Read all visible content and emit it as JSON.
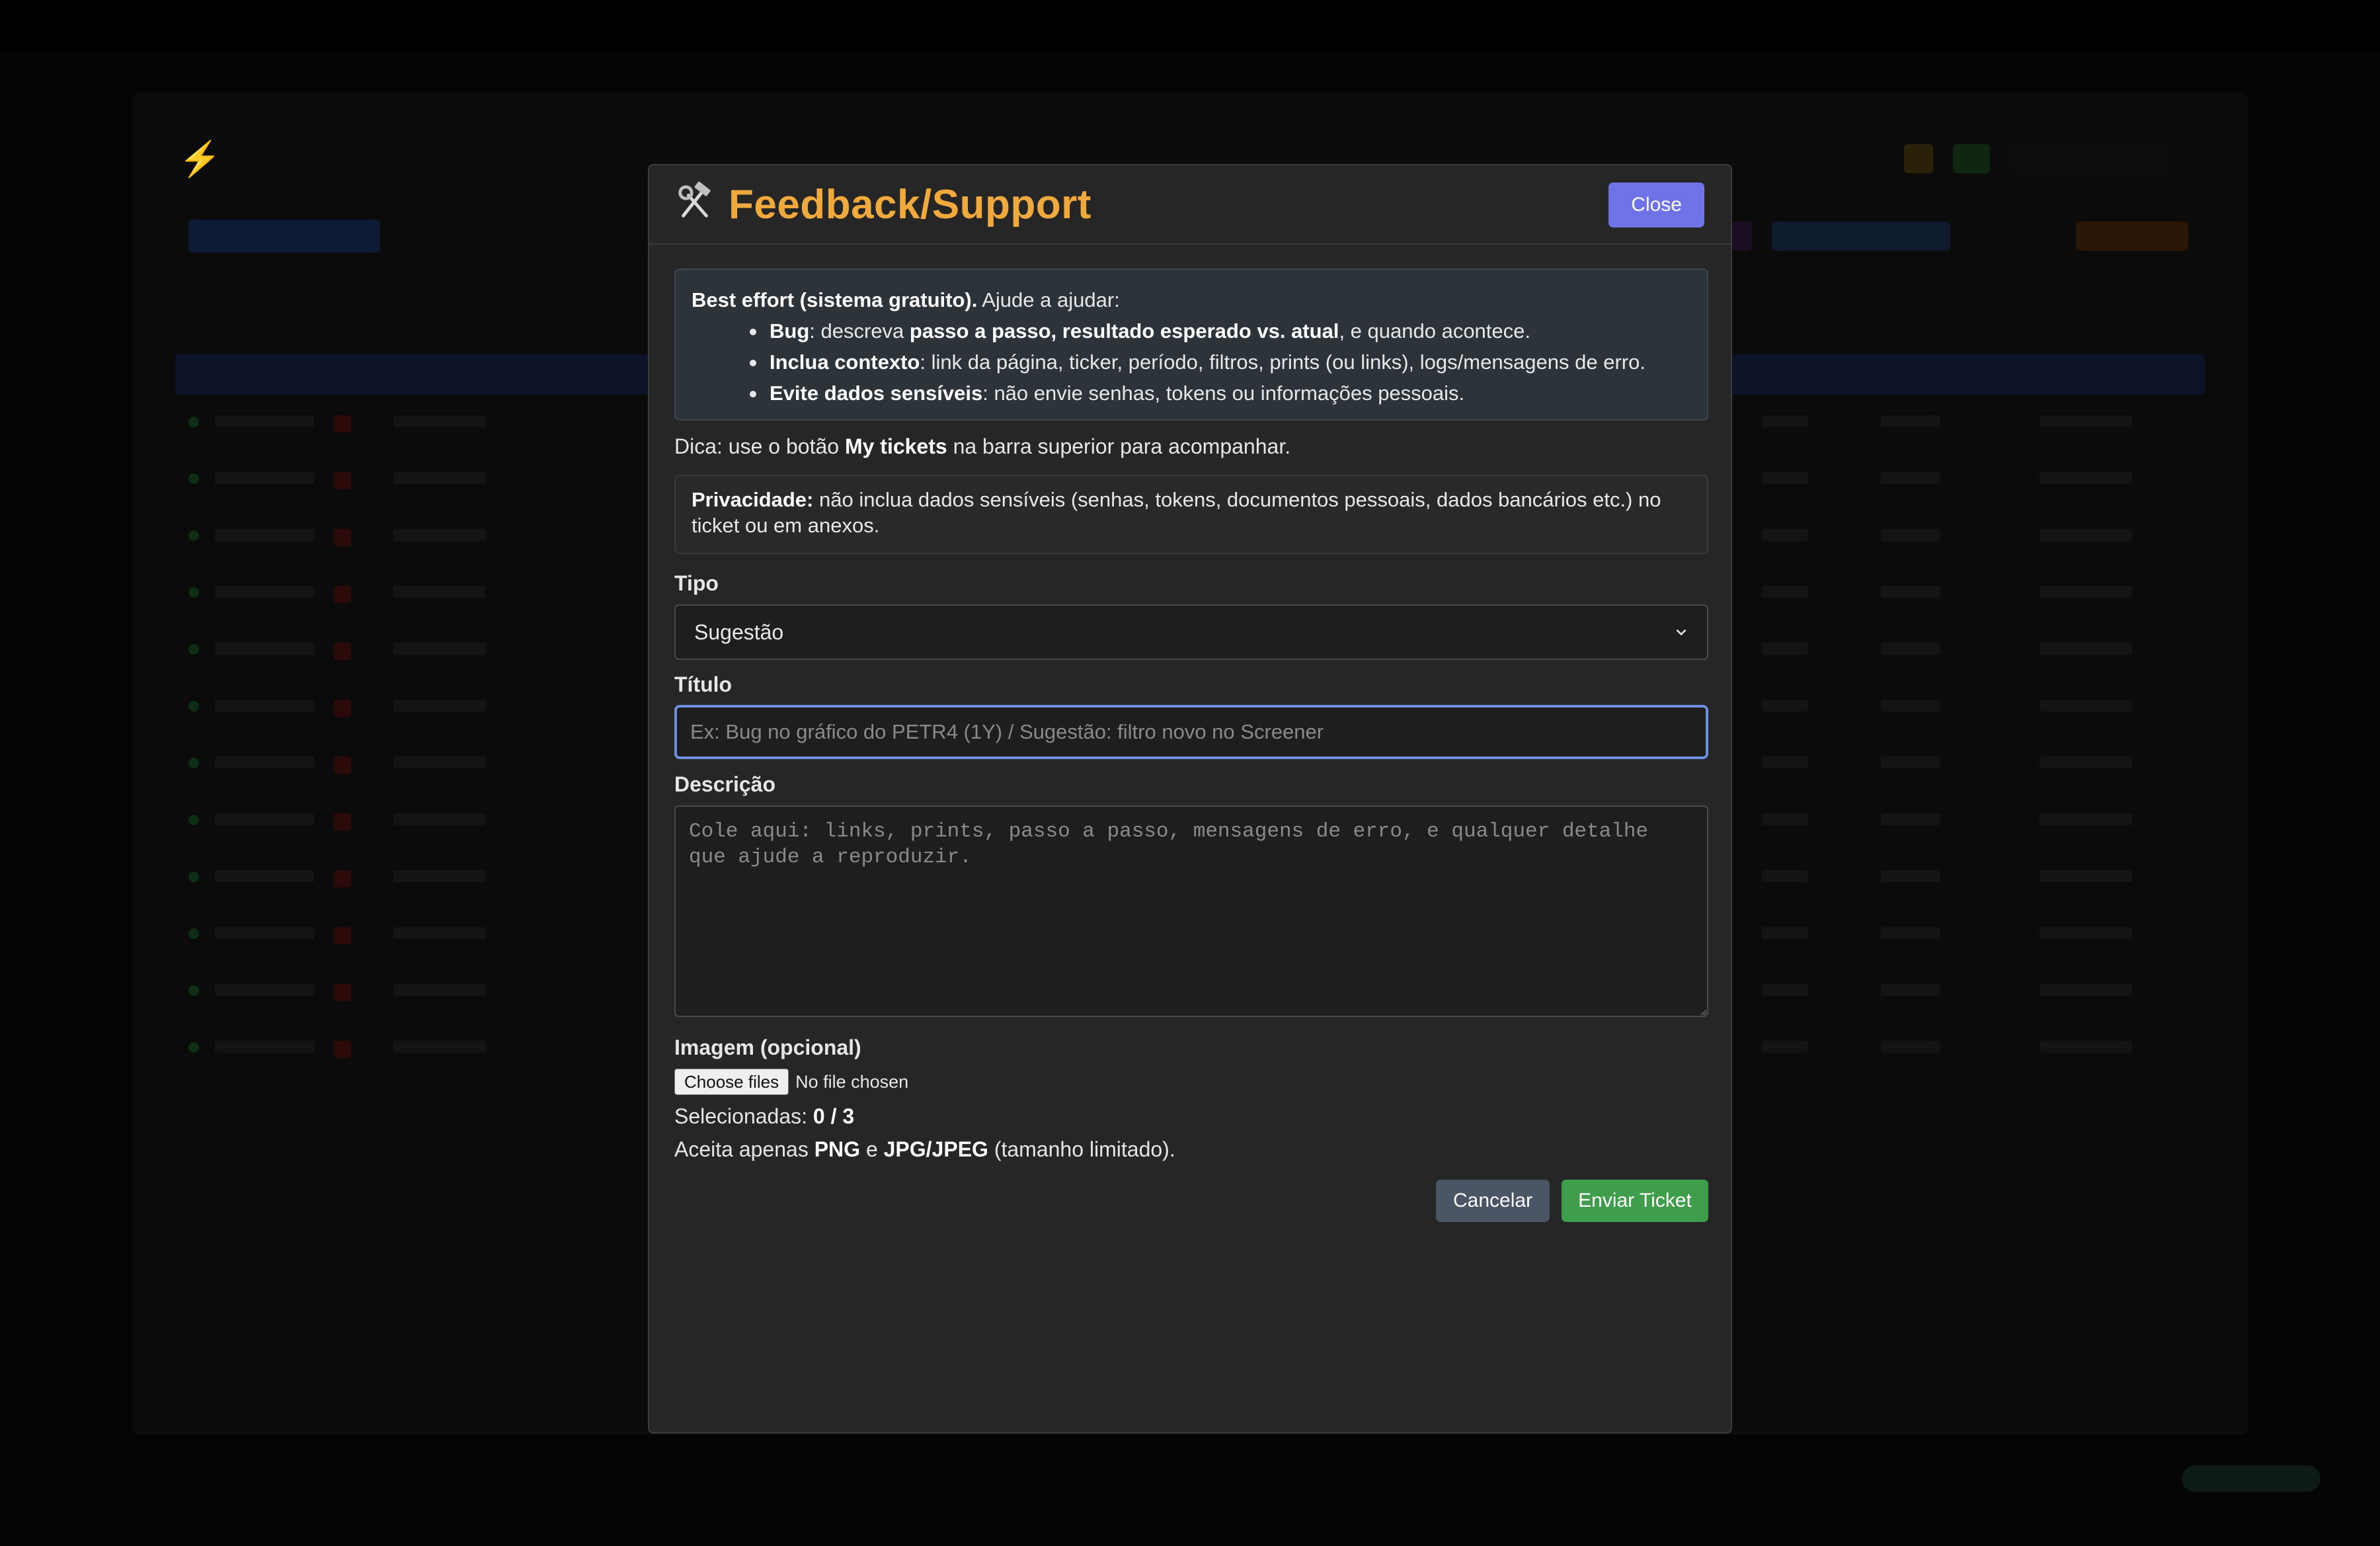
{
  "modal": {
    "icon": "hammer-and-wrench-icon",
    "title": "Feedback/Support",
    "close_label": "Close",
    "info": {
      "intro_bold": "Best effort (sistema gratuito).",
      "intro_rest": " Ajude a ajudar:",
      "items": [
        {
          "a": "Bug",
          "b": ": descreva ",
          "c": "passo a passo, resultado esperado vs. atual",
          "d": ", e quando acontece."
        },
        {
          "a": "Inclua contexto",
          "b": ": link da página, ticker, período, filtros, prints (ou links), logs/mensagens de erro.",
          "c": "",
          "d": ""
        },
        {
          "a": "Evite dados sensíveis",
          "b": ": não envie senhas, tokens ou informações pessoais.",
          "c": "",
          "d": ""
        }
      ]
    },
    "tip": {
      "pre": "Dica: use o botão ",
      "bold": "My tickets",
      "post": " na barra superior para acompanhar."
    },
    "privacy": {
      "bold": "Privacidade:",
      "text": " não inclua dados sensíveis (senhas, tokens, documentos pessoais, dados bancários etc.) no ticket ou em anexos."
    },
    "type_label": "Tipo",
    "type_value": "Sugestão",
    "title_label": "Título",
    "title_placeholder": "Ex: Bug no gráfico do PETR4 (1Y) / Sugestão: filtro novo no Screener",
    "description_label": "Descrição",
    "description_placeholder": "Cole aqui: links, prints, passo a passo, mensagens de erro, e qualquer detalhe que ajude a reproduzir.",
    "image_label": "Imagem (opcional)",
    "choose_files_label": "Choose files",
    "no_file_text": "No file chosen",
    "selected": {
      "label": "Selecionadas: ",
      "count": "0 / 3"
    },
    "accepted": {
      "pre": "Aceita apenas ",
      "png": "PNG",
      "mid": " e ",
      "jpg": "JPG/JPEG",
      "post": " (tamanho limitado)."
    },
    "cancel_label": "Cancelar",
    "submit_label": "Enviar Ticket"
  },
  "colors": {
    "title_accent": "#f0a93c",
    "close_button": "#6f73e8",
    "submit_button": "#3f9e4c",
    "cancel_button": "#4a5565",
    "focus_ring": "#6e8fe0"
  }
}
